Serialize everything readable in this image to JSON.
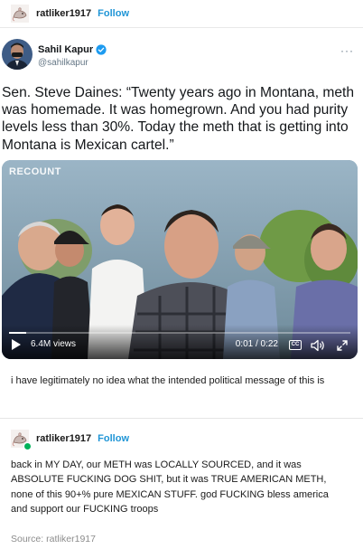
{
  "post": {
    "username": "ratliker1917",
    "follow_label": "Follow"
  },
  "tweet": {
    "display_name": "Sahil Kapur",
    "handle": "@sahilkapur",
    "more_icon": "···",
    "text": "Sen. Steve Daines: “Twenty years ago in Montana, meth was homemade. It was homegrown. And you had purity levels less than 30%. Today the meth that is getting into Montana is Mexican cartel.”",
    "video": {
      "watermark": "RECOUNT",
      "views": "6.4M views",
      "time": "0:01 / 0:22",
      "progress_fraction": 0.05,
      "cc_label": "CC"
    }
  },
  "comment": {
    "text": "i have legitimately no idea what the intended political message of this is"
  },
  "reblog": {
    "username": "ratliker1917",
    "follow_label": "Follow",
    "text": "back in MY DAY, our METH was LOCALLY SOURCED, and it was ABSOLUTE FUCKING DOG SHIT, but it was TRUE AMERICAN METH, none of this 90+% pure MEXICAN STUFF. god FUCKING bless america and support our FUCKING troops",
    "source": "Source: ratliker1917"
  },
  "colors": {
    "accent": "#1f95d6",
    "verified": "#1d9bf0",
    "badge": "#00b259"
  }
}
